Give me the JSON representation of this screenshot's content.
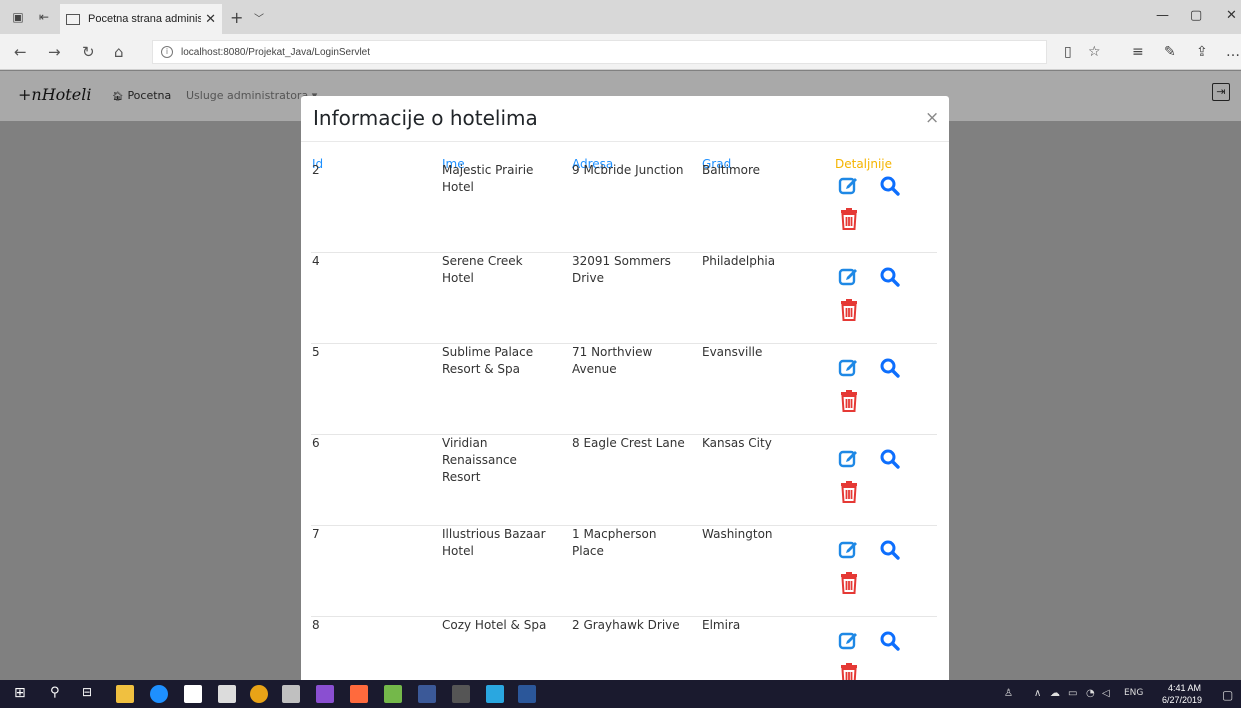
{
  "browser": {
    "tab_title": "Pocetna strana administ",
    "tab_close": "✕",
    "new_tab": "+",
    "url": "localhost:8080/Projekat_Java/LoginServlet"
  },
  "site": {
    "brand": "+nHoteli",
    "nav_home": "Pocetna",
    "nav_admin": "Usluge administratora ▾"
  },
  "modal": {
    "title": "Informacije o hotelima",
    "close": "×",
    "headers": {
      "id": "Id",
      "ime": "Ime",
      "adresa": "Adresa",
      "grad": "Grad",
      "detaljnije": "Detaljnije"
    },
    "rows": [
      {
        "id": "2",
        "ime": "Majestic Prairie Hotel",
        "adresa": "9 Mcbride Junction",
        "grad": "Baltimore"
      },
      {
        "id": "4",
        "ime": "Serene Creek Hotel",
        "adresa": "32091 Sommers Drive",
        "grad": "Philadelphia"
      },
      {
        "id": "5",
        "ime": "Sublime Palace Resort & Spa",
        "adresa": "71 Northview Avenue",
        "grad": "Evansville"
      },
      {
        "id": "6",
        "ime": "Viridian Renaissance Resort",
        "adresa": "8 Eagle Crest Lane",
        "grad": "Kansas City"
      },
      {
        "id": "7",
        "ime": "Illustrious Bazaar Hotel",
        "adresa": "1 Macpherson Place",
        "grad": "Washington"
      },
      {
        "id": "8",
        "ime": "Cozy Hotel & Spa",
        "adresa": "2 Grayhawk Drive",
        "grad": "Elmira"
      }
    ]
  },
  "taskbar": {
    "lang": "ENG",
    "time": "4:41 AM",
    "date": "6/27/2019"
  },
  "colors": {
    "header_blue": "#1e90ff",
    "header_gold": "#f5b400",
    "edit_blue": "#1e88e5",
    "search_blue": "#0d6efd",
    "trash_red": "#e53935"
  }
}
